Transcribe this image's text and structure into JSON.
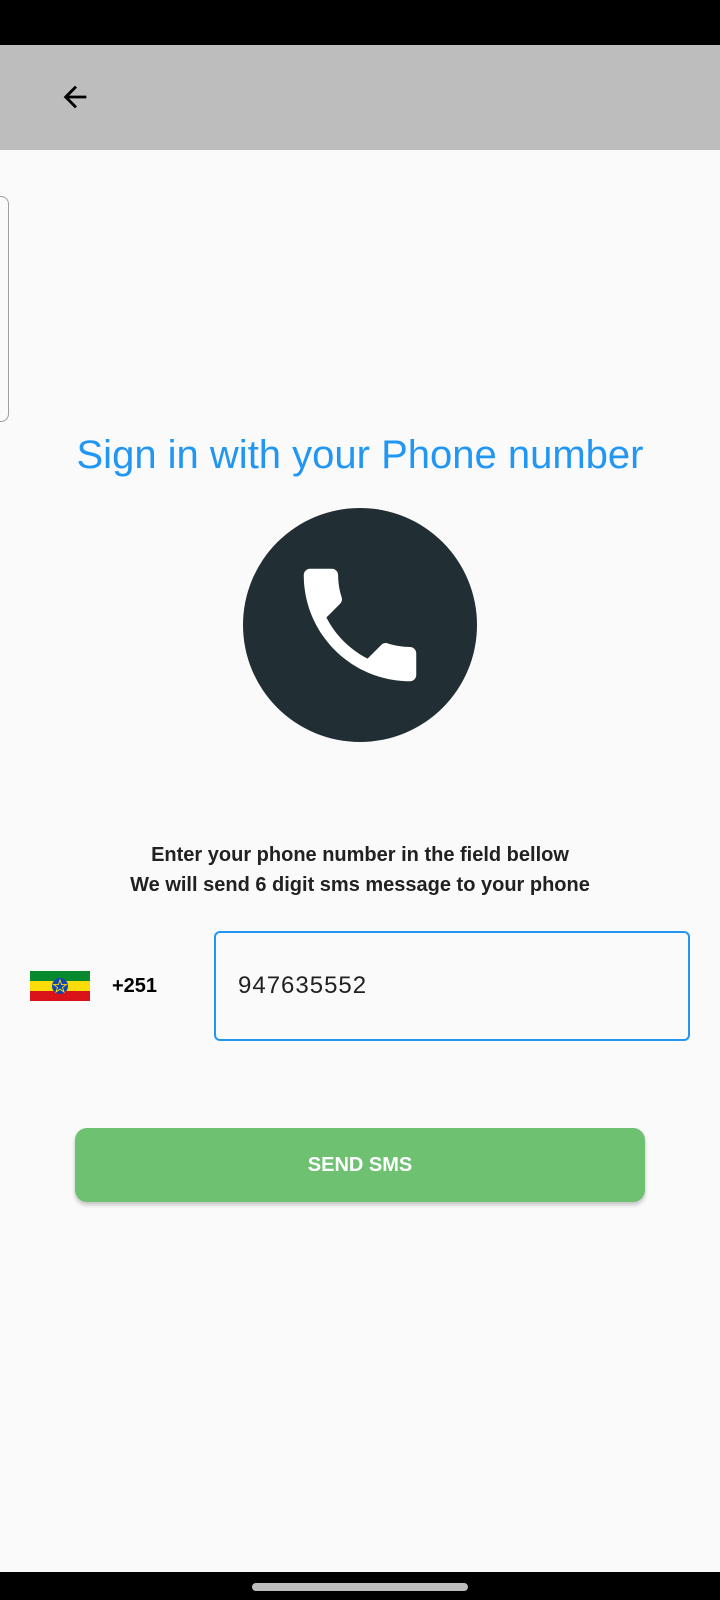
{
  "app_bar": {
    "back_icon": "arrow-left-icon"
  },
  "main": {
    "title": "Sign in with your Phone number",
    "phone_icon": "phone-handset-icon",
    "instructions": [
      "Enter your phone number in the field bellow",
      "We will send 6 digit sms message to your phone"
    ],
    "country": {
      "flag_icon": "ethiopia-flag-icon",
      "dial_code": "+251"
    },
    "phone_input": {
      "value": "947635552"
    },
    "send_button_label": "SEND SMS"
  },
  "colors": {
    "accent": "#2196f3",
    "button": "#6fc172",
    "app_bar": "#bdbdbd",
    "icon_circle": "#212e33"
  }
}
